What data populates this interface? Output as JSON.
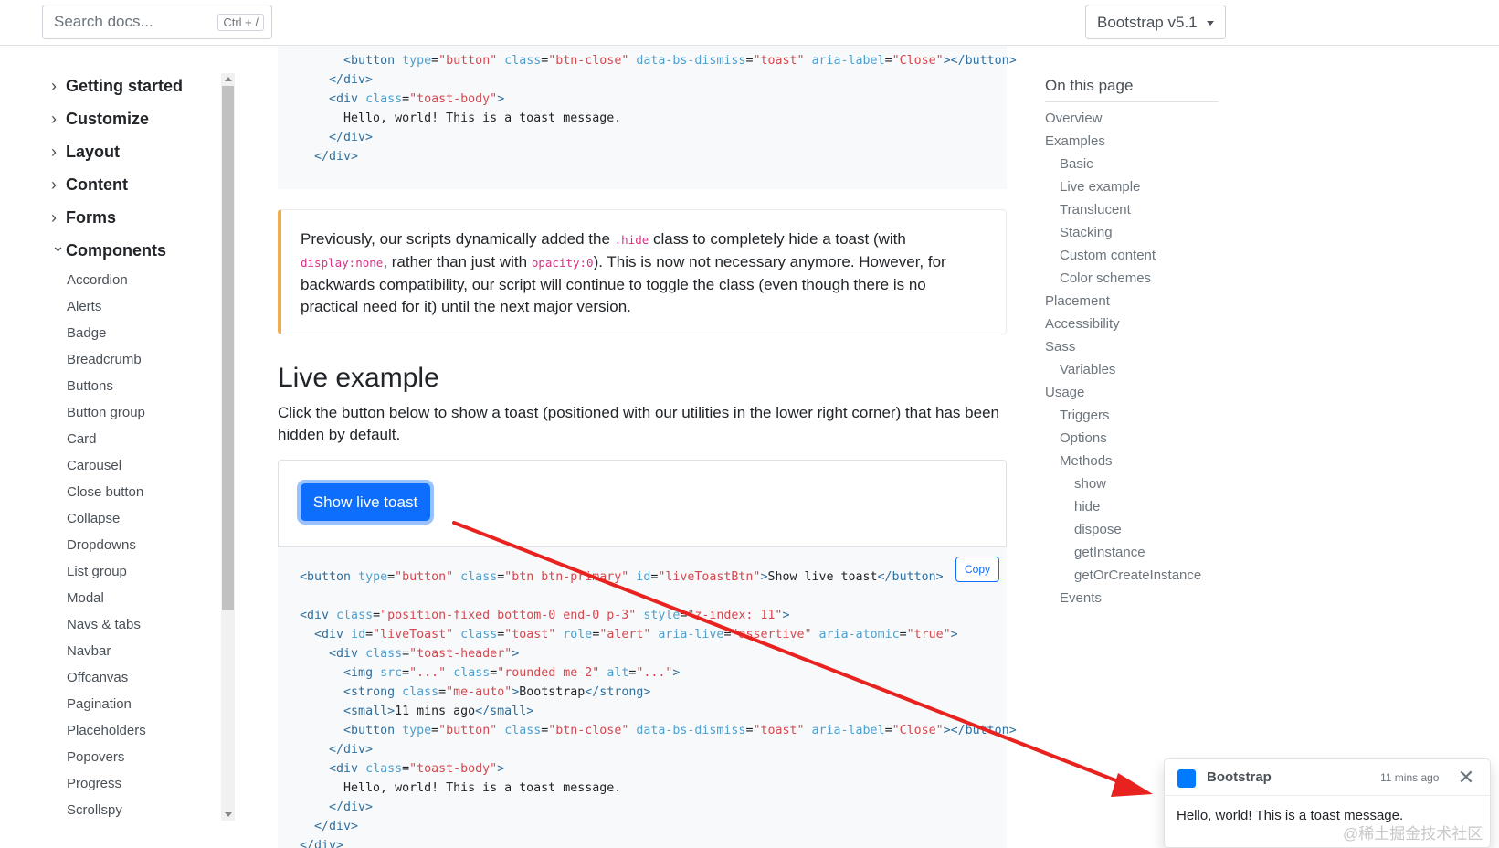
{
  "header": {
    "search_placeholder": "Search docs...",
    "search_shortcut": "Ctrl + /",
    "version_label": "Bootstrap v5.1"
  },
  "sidebar": {
    "groups": [
      {
        "label": "Getting started",
        "expanded": false
      },
      {
        "label": "Customize",
        "expanded": false
      },
      {
        "label": "Layout",
        "expanded": false
      },
      {
        "label": "Content",
        "expanded": false
      },
      {
        "label": "Forms",
        "expanded": false
      },
      {
        "label": "Components",
        "expanded": true
      }
    ],
    "components": [
      "Accordion",
      "Alerts",
      "Badge",
      "Breadcrumb",
      "Buttons",
      "Button group",
      "Card",
      "Carousel",
      "Close button",
      "Collapse",
      "Dropdowns",
      "List group",
      "Modal",
      "Navs & tabs",
      "Navbar",
      "Offcanvas",
      "Pagination",
      "Placeholders",
      "Popovers",
      "Progress",
      "Scrollspy"
    ]
  },
  "main": {
    "callout": {
      "p1": "Previously, our scripts dynamically added the ",
      "code1": ".hide",
      "p2": " class to completely hide a toast (with ",
      "code2": "display:none",
      "p3": ", rather than just with ",
      "code3": "opacity:0",
      "p4": "). This is now not necessary anymore. However, for backwards compatibility, our script will continue to toggle the class (even though there is no practical need for it) until the next major version."
    },
    "section_title": "Live example",
    "section_lead": "Click the button below to show a toast (positioned with our utilities in the lower right corner) that has been hidden by default.",
    "live_button_label": "Show live toast",
    "copy_label": "Copy"
  },
  "toc": {
    "title": "On this page",
    "items": [
      {
        "label": "Overview",
        "level": 1
      },
      {
        "label": "Examples",
        "level": 1
      },
      {
        "label": "Basic",
        "level": 2
      },
      {
        "label": "Live example",
        "level": 2
      },
      {
        "label": "Translucent",
        "level": 2
      },
      {
        "label": "Stacking",
        "level": 2
      },
      {
        "label": "Custom content",
        "level": 2
      },
      {
        "label": "Color schemes",
        "level": 2
      },
      {
        "label": "Placement",
        "level": 1
      },
      {
        "label": "Accessibility",
        "level": 1
      },
      {
        "label": "Sass",
        "level": 1
      },
      {
        "label": "Variables",
        "level": 2
      },
      {
        "label": "Usage",
        "level": 1
      },
      {
        "label": "Triggers",
        "level": 2
      },
      {
        "label": "Options",
        "level": 2
      },
      {
        "label": "Methods",
        "level": 2
      },
      {
        "label": "show",
        "level": 3
      },
      {
        "label": "hide",
        "level": 3
      },
      {
        "label": "dispose",
        "level": 3
      },
      {
        "label": "getInstance",
        "level": 3
      },
      {
        "label": "getOrCreateInstance",
        "level": 3
      },
      {
        "label": "Events",
        "level": 2
      }
    ]
  },
  "toast": {
    "title": "Bootstrap",
    "time": "11 mins ago",
    "body": "Hello, world! This is a toast message.",
    "close_glyph": "✕"
  },
  "watermark": "@稀土掘金技术社区",
  "colors": {
    "primary": "#0d6efd",
    "warning_border": "#f0ad4e",
    "annotation_arrow": "#e8231f"
  }
}
